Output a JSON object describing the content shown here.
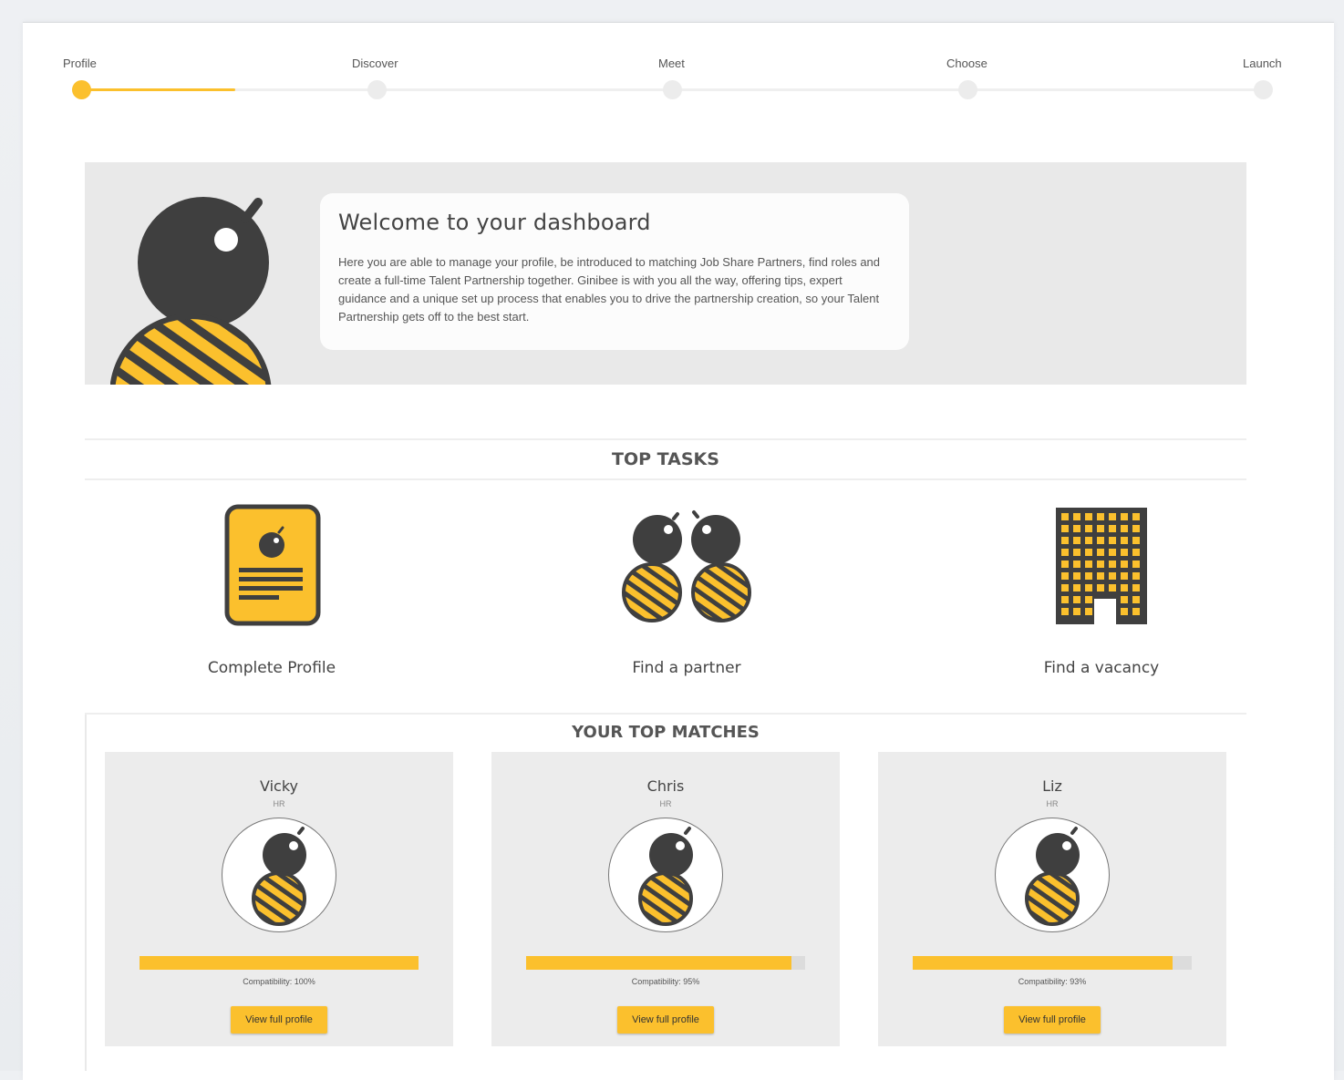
{
  "stepper": {
    "steps": [
      "Profile",
      "Discover",
      "Meet",
      "Choose",
      "Launch"
    ],
    "current": 0,
    "progress_fraction": 0.13
  },
  "welcome": {
    "title": "Welcome to your dashboard",
    "text": "Here you are able to manage your profile, be introduced to matching Job Share Partners, find roles and create a full-time Talent Partnership together. Ginibee is with you all the way, offering tips, expert guidance and a unique set up process that enables you to drive the partnership creation, so your Talent Partnership gets off to the best start."
  },
  "top_tasks": {
    "heading": "TOP TASKS",
    "items": [
      {
        "label": "Complete Profile",
        "icon": "profile-card-icon"
      },
      {
        "label": "Find a partner",
        "icon": "two-bees-icon"
      },
      {
        "label": "Find a vacancy",
        "icon": "office-building-icon"
      }
    ]
  },
  "matches": {
    "heading": "YOUR TOP MATCHES",
    "items": [
      {
        "name": "Vicky",
        "role": "HR",
        "compatibility": "Compatibility: 100%",
        "compat_value": 1.0,
        "button": "View full profile"
      },
      {
        "name": "Chris",
        "role": "HR",
        "compatibility": "Compatibility: 95%",
        "compat_value": 0.95,
        "button": "View full profile"
      },
      {
        "name": "Liz",
        "role": "HR",
        "compatibility": "Compatibility: 93%",
        "compat_value": 0.93,
        "button": "View full profile"
      }
    ]
  },
  "colors": {
    "accent": "#fbc02d",
    "dark": "#3f3f3f",
    "panel": "#ececec"
  }
}
